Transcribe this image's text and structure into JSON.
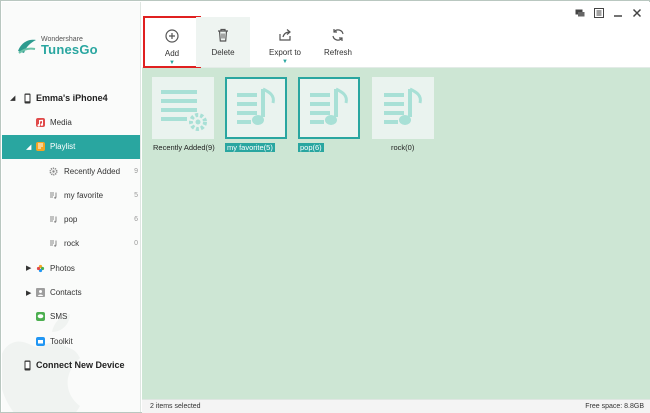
{
  "app": {
    "brand_small": "Wondershare",
    "brand_big": "TunesGo",
    "accent_color": "#29a6a0"
  },
  "window_controls": [
    {
      "name": "feedback-icon"
    },
    {
      "name": "menu-icon"
    },
    {
      "name": "minimize-icon"
    },
    {
      "name": "close-icon"
    }
  ],
  "sidebar": {
    "device": "Emma's iPhone4",
    "items": [
      {
        "label": "Media",
        "icon": "media-icon"
      },
      {
        "label": "Playlist",
        "icon": "playlist-icon"
      },
      {
        "label": "Recently Added",
        "count": "9",
        "icon": "gear-icon"
      },
      {
        "label": "my favorite",
        "count": "5",
        "icon": "playlist-small-icon"
      },
      {
        "label": "pop",
        "count": "6",
        "icon": "playlist-small-icon"
      },
      {
        "label": "rock",
        "count": "0",
        "icon": "playlist-small-icon"
      },
      {
        "label": "Photos",
        "icon": "photos-icon"
      },
      {
        "label": "Contacts",
        "icon": "contacts-icon"
      },
      {
        "label": "SMS",
        "icon": "sms-icon"
      },
      {
        "label": "Toolkit",
        "icon": "toolkit-icon"
      }
    ],
    "connect": "Connect New Device"
  },
  "toolbar": {
    "add": "Add",
    "delete": "Delete",
    "export": "Export to",
    "refresh": "Refresh"
  },
  "playlists": [
    {
      "caption": "Recently Added(9)",
      "selected": false
    },
    {
      "caption": "my favorite(5)",
      "selected": true
    },
    {
      "caption": "pop(6)",
      "selected": true
    },
    {
      "caption": "rock(0)",
      "selected": false
    }
  ],
  "status": {
    "selected": "2 items selected",
    "free_space": "Free space: 8.8GB"
  }
}
